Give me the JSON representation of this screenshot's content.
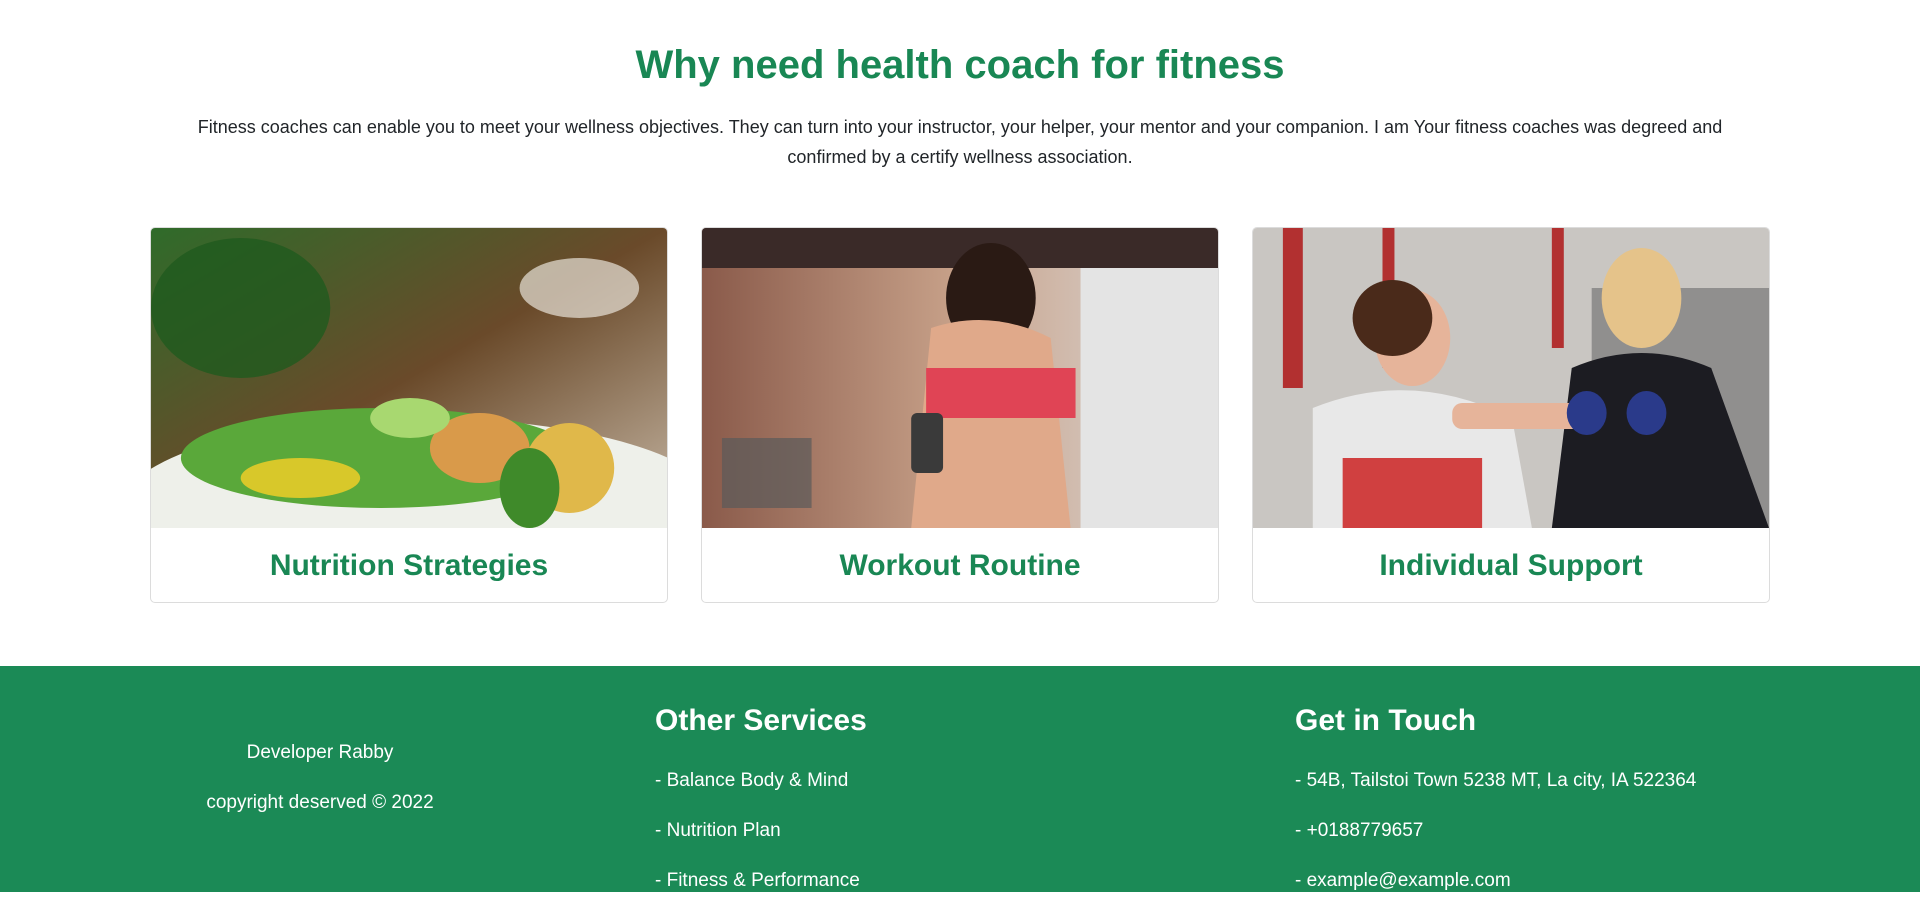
{
  "intro": {
    "title": "Why need health coach for fitness",
    "description": "Fitness coaches can enable you to meet your wellness objectives. They can turn into your instructor, your helper, your mentor and your companion. I am Your fitness coaches was degreed and confirmed by a certify wellness association."
  },
  "cards": [
    {
      "title": "Nutrition Strategies",
      "image": "salad-photo"
    },
    {
      "title": "Workout Routine",
      "image": "runner-photo"
    },
    {
      "title": "Individual Support",
      "image": "trainer-photo"
    }
  ],
  "footer": {
    "brand": {
      "developer": "Developer Rabby",
      "copyright": "copyright deserved © 2022"
    },
    "services": {
      "heading": "Other Services",
      "items": [
        "- Balance Body & Mind",
        "- Nutrition Plan",
        "- Fitness & Performance"
      ]
    },
    "contact": {
      "heading": "Get in Touch",
      "items": [
        "- 54B, Tailstoi Town 5238 MT, La city, IA 522364",
        "- +0188779657",
        "- example@example.com"
      ]
    }
  },
  "colors": {
    "accent": "#198754",
    "footer_bg": "#1b8a56"
  }
}
